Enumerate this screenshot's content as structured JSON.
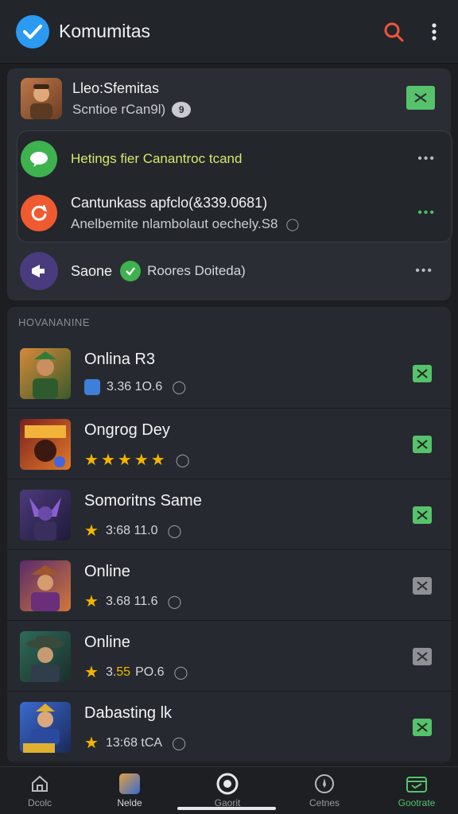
{
  "app": {
    "title": "Komumitas"
  },
  "top_card": {
    "user": {
      "name": "Lleo:Sfemitas",
      "sub": "Scntioe rCan9l)"
    },
    "notifications": [
      {
        "text": "Hetings fier Canantroc tcand",
        "accent": "#d6e86a"
      },
      {
        "title": "Cantunkass apfclo(&339.0681)",
        "sub": "Anelbemite nlambolaut oechely.S8"
      }
    ],
    "footer": {
      "left": "Saone",
      "right": "Roores Doiteda)"
    }
  },
  "section": {
    "label": "HOVANANINE",
    "items": [
      {
        "name": "Onlina R3",
        "rating_text": "3.36 1O.6",
        "stars": 0,
        "checked": true
      },
      {
        "name": "Ongrog Dey",
        "rating_text": "",
        "stars": 5,
        "checked": true
      },
      {
        "name": "Somoritns Same",
        "rating_text": "3:68 11.0",
        "stars": 1,
        "checked": true
      },
      {
        "name": "Online",
        "rating_text": "3.68 11.6",
        "stars": 1,
        "checked": false
      },
      {
        "name": "Online",
        "rating_text_a": "3.",
        "rating_text_b": "55",
        "rating_text_c": "PO.6",
        "stars": 1,
        "checked": false
      },
      {
        "name": "Dabasting lk",
        "rating_text": "13:68 tCA",
        "stars": 1,
        "checked": true
      }
    ]
  },
  "nav": [
    {
      "label": "Dcolc"
    },
    {
      "label": "Nelde"
    },
    {
      "label": "Gaorit"
    },
    {
      "label": "Cetnes"
    },
    {
      "label": "Gootrate"
    }
  ],
  "colors": {
    "accent_green": "#56c26b",
    "search_red": "#f0553b",
    "star": "#f4b400"
  }
}
